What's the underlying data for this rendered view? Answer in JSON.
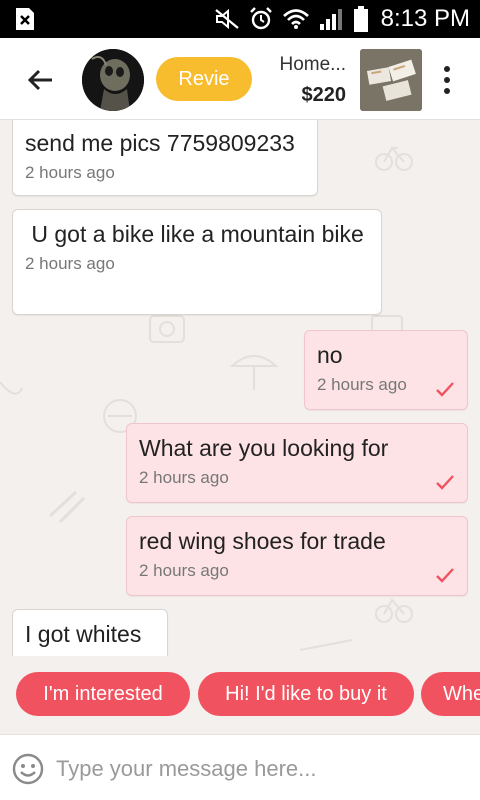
{
  "status_bar": {
    "time": "8:13 PM",
    "icons": [
      "sim-card-icon",
      "mute-icon",
      "alarm-icon",
      "wifi-icon",
      "signal-icon",
      "battery-icon"
    ]
  },
  "header": {
    "back_icon": "arrow-left-icon",
    "review_label": "Revie",
    "listing_title": "Home...",
    "listing_price": "$220",
    "more_icon": "more-vertical-icon"
  },
  "messages": [
    {
      "direction": "incoming",
      "text": "send me pics 7759809233",
      "time": "2 hours ago"
    },
    {
      "direction": "incoming",
      "text": " U got a bike like a mountain bike",
      "time": "2 hours ago"
    },
    {
      "direction": "outgoing",
      "text": "no",
      "time": "2 hours ago",
      "status": "sent"
    },
    {
      "direction": "outgoing",
      "text": "What are you looking for",
      "time": "2 hours ago",
      "status": "sent"
    },
    {
      "direction": "outgoing",
      "text": "red wing shoes for trade",
      "time": "2 hours ago",
      "status": "sent"
    },
    {
      "direction": "incoming",
      "text": "I got whites",
      "time": ""
    }
  ],
  "quick_replies": [
    "I'm interested",
    "Hi! I'd like to buy it",
    "Whe"
  ],
  "composer": {
    "placeholder": "Type your message here...",
    "value": ""
  },
  "colors": {
    "accent": "#f1525f",
    "review_button": "#f8bd2e",
    "incoming_bubble": "#ffffff",
    "outgoing_bubble": "#fde3e6",
    "chat_background": "#f4f0ee"
  }
}
